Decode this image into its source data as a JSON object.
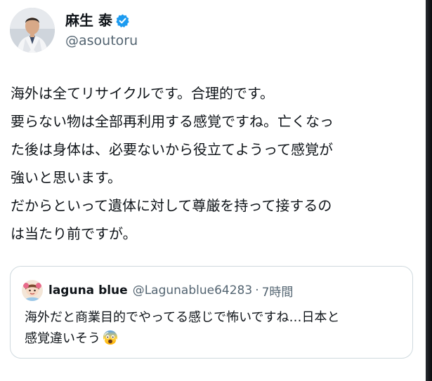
{
  "author": {
    "display_name": "麻生 泰",
    "handle": "@asoutoru",
    "verified": true
  },
  "post": {
    "lines": [
      "海外は全てリサイクルです。合理的です。",
      "要らない物は全部再利用する感覚ですね。亡くなっ",
      "た後は身体は、必要ないから役立てようって感覚が",
      "強いと思います。",
      "だからといって遺体に対して尊厳を持って接するの",
      "は当たり前ですが。"
    ]
  },
  "quoted_post": {
    "display_name": "laguna blue",
    "handle": "@Lagunablue64283",
    "separator": "·",
    "time": "7時間",
    "lines": [
      "海外だと商業目的でやってる感じで怖いですね…日本と",
      "感覚違いそう"
    ],
    "emoji": "fearful-face-emoji"
  },
  "colors": {
    "text": "#0f1419",
    "secondary": "#536471",
    "verified_blue": "#1d9bf0",
    "border": "#cfd9de"
  }
}
